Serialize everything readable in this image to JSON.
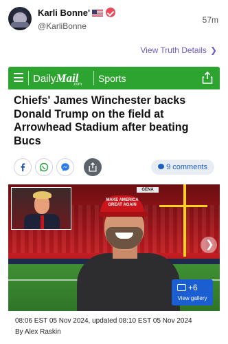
{
  "post": {
    "display_name": "Karli Bonne'",
    "handle": "@KarliBonne",
    "time": "57m",
    "view_link": "View Truth Details"
  },
  "card": {
    "brand_daily": "Daily",
    "brand_mail": "Mail",
    "brand_com": ".com",
    "section": "Sports",
    "headline": "Chiefs' James Winchester backs Donald Trump on the field at Arrowhead Stadium after beating Bucs",
    "comments": "9 comments",
    "gallery_count": "+6",
    "gallery_label": "View gallery",
    "stadium_sign": "GENA",
    "cap_text": "MAKE AMERICA GREAT AGAIN",
    "timestamp": "08:06 EST 05 Nov 2024, updated 08:10 EST 05 Nov 2024",
    "byline": "By Alex Raskin"
  },
  "colors": {
    "brand_green": "#2da430",
    "link_purple": "#6b5cc9",
    "verified_red": "#e94b5c",
    "gallery_blue": "#1a5ed1",
    "comments_blue": "#1f5fbf"
  },
  "icons": [
    "menu-icon",
    "share-icon",
    "facebook-icon",
    "whatsapp-icon",
    "messenger-icon",
    "comment-icon",
    "gallery-icon",
    "chevron-right-icon",
    "flag-icon",
    "verified-icon"
  ]
}
